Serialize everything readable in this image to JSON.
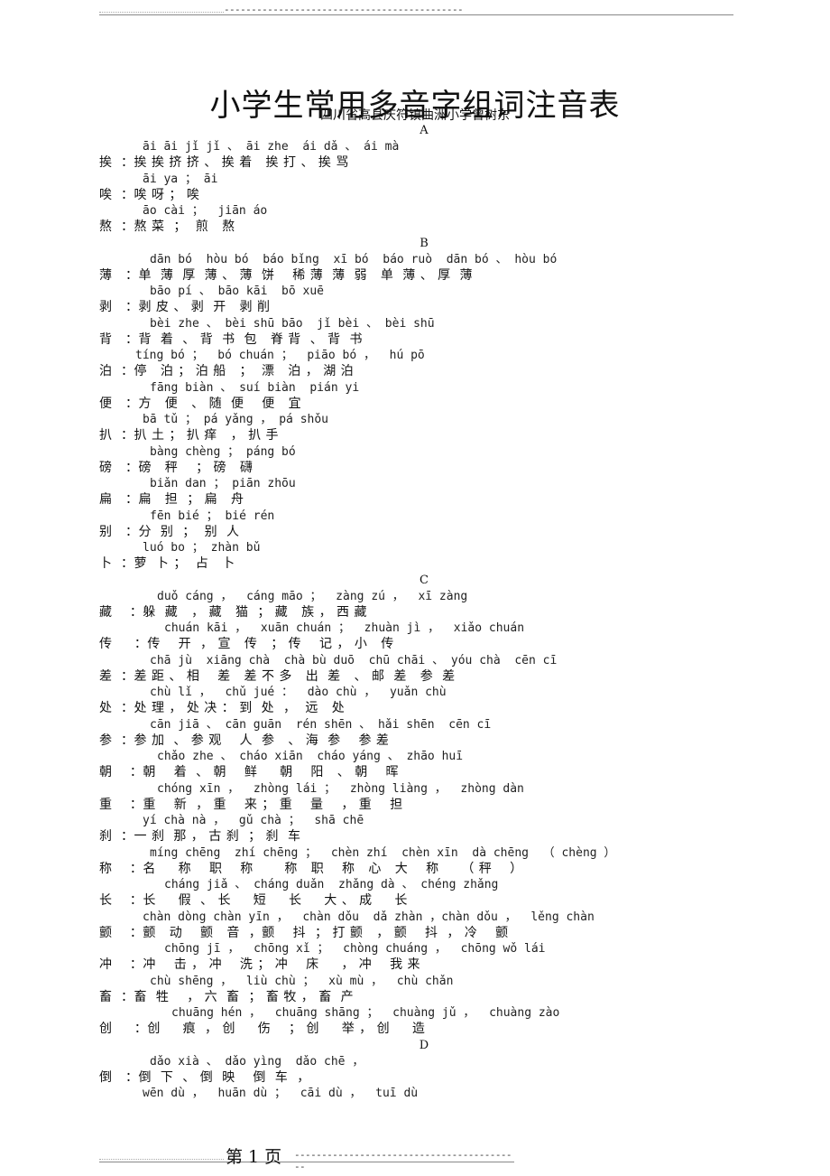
{
  "header": {
    "dash_line": "--------------------------------------------"
  },
  "title": "小学生常用多音字组词注音表",
  "subtitle": "四川省高县庆符镇曲洲小学曾树东",
  "sections": [
    {
      "letter": "A",
      "entries": [
        {
          "char": "挨",
          "pinyin": "āi āi jǐ jǐ 、 āi zhe  ái dǎ 、 ái mà",
          "words": "挨 挨 挤 挤 、 挨 着   挨 打 、 挨 骂",
          "py_indent": 6,
          "zh_sep": "："
        },
        {
          "char": "唉",
          "pinyin": "āi ya ； āi",
          "words": "唉 呀 ； 唉",
          "py_indent": 6,
          "zh_sep": "："
        },
        {
          "char": "熬",
          "pinyin": "āo cài ；  jiān áo",
          "words": "熬 菜  ；  煎   熬",
          "py_indent": 6,
          "zh_sep": "："
        }
      ]
    },
    {
      "letter": "B",
      "entries": [
        {
          "char": "薄",
          "pinyin": "dān bó  hòu bó  báo bǐng  xī bó  báo ruò  dān bó 、 hòu bó",
          "words": "单  薄  厚  薄 、 薄  饼    稀 薄  薄  弱   单  薄 、 厚  薄",
          "py_indent": 7,
          "zh_sep": " ："
        },
        {
          "char": "剥",
          "pinyin": "bāo pí 、 bāo kāi  bō xuē",
          "words": "剥 皮 、 剥  开   剥 削",
          "py_indent": 7,
          "zh_sep": " ："
        },
        {
          "char": "背",
          "pinyin": "bèi zhe 、 bèi shū bāo  jǐ bèi 、 bèi shū",
          "words": "背  着  、 背  书  包   脊 背  、 背  书",
          "py_indent": 7,
          "zh_sep": " ："
        },
        {
          "char": "泊",
          "pinyin": "tíng bó ；  bó chuán ；  piāo bó ，  hú pō",
          "words": "停   泊 ； 泊 船   ；  漂   泊 ， 湖 泊",
          "py_indent": 5,
          "zh_sep": "："
        },
        {
          "char": "便",
          "pinyin": "fāng biàn 、 suí biàn  pián yi",
          "words": "方   便   、 随  便    便   宜",
          "py_indent": 7,
          "zh_sep": " ："
        },
        {
          "char": "扒",
          "pinyin": "bā tǔ ； pá yǎng ， pá shǒu",
          "words": "扒 土 ； 扒 痒   ， 扒 手",
          "py_indent": 6,
          "zh_sep": "："
        },
        {
          "char": "磅",
          "pinyin": "bàng chèng ； páng bó",
          "words": "磅   秤    ； 磅   礴",
          "py_indent": 7,
          "zh_sep": " ："
        },
        {
          "char": "扁",
          "pinyin": "biǎn dan ； piān zhōu",
          "words": "扁   担  ； 扁   舟",
          "py_indent": 7,
          "zh_sep": " ："
        },
        {
          "char": "别",
          "pinyin": "fēn bié ； bié rén",
          "words": "分  别  ；  别  人",
          "py_indent": 7,
          "zh_sep": " ："
        },
        {
          "char": "卜",
          "pinyin": "luó bo ； zhàn bǔ",
          "words": "萝  卜 ；  占   卜",
          "py_indent": 6,
          "zh_sep": "："
        }
      ]
    },
    {
      "letter": "C",
      "entries": [
        {
          "char": "藏",
          "pinyin": "duǒ cáng ，  cáng māo ；  zàng zú ，  xī zàng",
          "words": "躲  藏   ， 藏   猫  ； 藏   族 ， 西 藏",
          "py_indent": 8,
          "zh_sep": "  ："
        },
        {
          "char": "传",
          "pinyin": "chuán kāi ，  xuān chuán ；  zhuàn jì ，  xiǎo chuán",
          "words": "传    开  ， 宣   传   ； 传    记 ， 小   传",
          "py_indent": 9,
          "zh_sep": "   ："
        },
        {
          "char": "差",
          "pinyin": "chā jù  xiāng chà  chà bù duō  chū chāi 、 yóu chà  cēn cī",
          "words": "差 距 、 相    差   差 不 多   出  差   、 邮  差   参  差",
          "py_indent": 7,
          "zh_sep": "："
        },
        {
          "char": "处",
          "pinyin": "chù lǐ ，  chǔ jué ：  dào chù ，  yuǎn chù",
          "words": "处 理 ， 处 决 ： 到  处  ，  远   处",
          "py_indent": 7,
          "zh_sep": "："
        },
        {
          "char": "参",
          "pinyin": "cān jiā 、 cān guān  rén shēn 、 hǎi shēn  cēn cī",
          "words": "参 加  、 参 观    人  参   、 海  参    参 差",
          "py_indent": 7,
          "zh_sep": "："
        },
        {
          "char": "朝",
          "pinyin": "chǎo zhe 、 cháo xiān  cháo yáng 、 zhāo huī",
          "words": "朝    着  、 朝    鲜     朝    阳   、 朝    晖",
          "py_indent": 8,
          "zh_sep": "  ："
        },
        {
          "char": "重",
          "pinyin": "chóng xīn ，  zhòng lái ；  zhòng liàng ，  zhòng dàn",
          "words": "重    新  ， 重    来 ； 重    量    ， 重    担",
          "py_indent": 8,
          "zh_sep": "  ："
        },
        {
          "char": "刹",
          "pinyin": "yí chà nà ，  gǔ chà ；  shā chē",
          "words": "一 刹  那 ， 古 刹  ； 刹  车",
          "py_indent": 6,
          "zh_sep": "："
        },
        {
          "char": "称",
          "pinyin": "míng chēng  zhí chēng ；  chèn zhí  chèn xīn  dà chēng  （ chèng ）",
          "words": "名     称    职    称       称   职    称   心   大    称     （ 秤    ）",
          "py_indent": 7,
          "zh_sep": "  ："
        },
        {
          "char": "长",
          "pinyin": "cháng jiǎ 、 cháng duǎn  zhǎng dà 、 chéng zhǎng",
          "words": "长     假  、 长     短     长     大 、 成     长",
          "py_indent": 9,
          "zh_sep": "  ："
        },
        {
          "char": "颤",
          "pinyin": "chàn dòng chàn yīn ，  chàn dǒu  dǎ zhàn ，chàn dǒu ，  lěng chàn",
          "words": "颤   动    颤   音  ，颤    抖  ； 打 颤   ， 颤    抖  ， 冷    颤",
          "py_indent": 6,
          "zh_sep": "  ："
        },
        {
          "char": "冲",
          "pinyin": "chōng jī ，  chōng xǐ ；  chòng chuáng ，  chōng wǒ lái",
          "words": "冲    击 ， 冲    洗 ； 冲    床     ， 冲    我 来",
          "py_indent": 9,
          "zh_sep": "  ："
        },
        {
          "char": "畜",
          "pinyin": "chù shēng ，  liù chù ；  xù mù ，  chù chǎn",
          "words": "畜  牲    ， 六  畜  ； 畜 牧 ， 畜  产",
          "py_indent": 7,
          "zh_sep": "："
        },
        {
          "char": "创",
          "pinyin": "chuāng hén ，  chuāng shāng ；  chuàng jǔ ，  chuàng zào",
          "words": "创     痕  ， 创     伤    ； 创     举 ， 创     造",
          "py_indent": 10,
          "zh_sep": "   ："
        }
      ]
    },
    {
      "letter": "D",
      "entries": [
        {
          "char": "倒",
          "pinyin": "dǎo xià 、 dǎo yìng  dǎo chē ，",
          "words": "倒  下  、 倒  映    倒  车  ，",
          "py_indent": 7,
          "zh_sep": " ："
        }
      ]
    }
  ],
  "trailing_pinyin": "wēn dù ，  huān dù ；  cāi dù ，  tuī dù",
  "footer": {
    "page_label": "第 1 页",
    "dash_line": "------------------------------------------"
  }
}
